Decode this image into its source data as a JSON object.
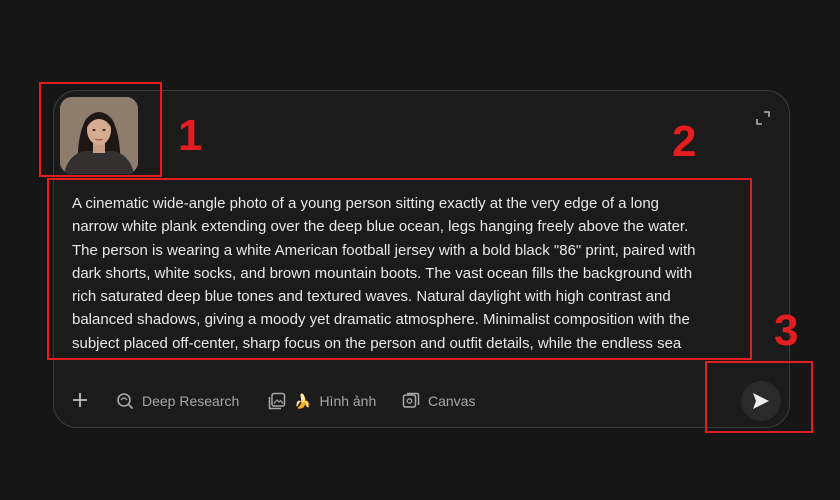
{
  "attachment": {
    "alt": "Portrait photo of a young woman"
  },
  "prompt": {
    "lines": [
      "A cinematic wide-angle photo of a young person sitting exactly at the very edge of a long",
      "narrow white plank extending over the deep blue ocean, legs hanging freely above the water.",
      "The person is wearing a white American football jersey with a bold black \"86\" print, paired with",
      "dark shorts, white socks, and brown mountain boots. The vast ocean fills the background with",
      "rich saturated deep blue tones and textured waves. Natural daylight with high contrast and",
      "balanced shadows, giving a moody yet dramatic atmosphere. Minimalist composition with the",
      "subject placed off-center, sharp focus on the person and outfit details, while the endless sea"
    ]
  },
  "toolbar": {
    "deep_research": "Deep Research",
    "image_emoji": "🍌",
    "image_label": "Hình ảnh",
    "canvas": "Canvas"
  },
  "annotations": {
    "one": "1",
    "two": "2",
    "three": "3"
  },
  "colors": {
    "annotation": "#e41e1e",
    "background": "#161616",
    "text": "#e8e8e8",
    "muted": "#a8a8a8"
  }
}
